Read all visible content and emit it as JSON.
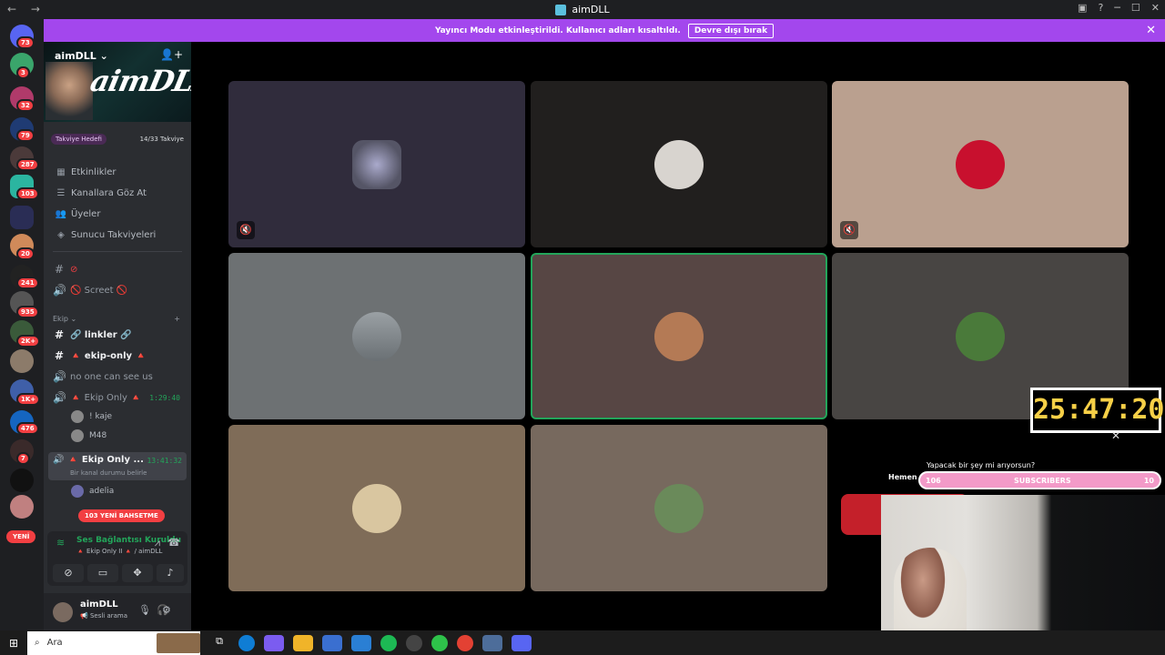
{
  "window": {
    "title": "aimDLL"
  },
  "banner": {
    "message": "Yayıncı Modu etkinleştirildi. Kullanıcı adları kısaltıldı.",
    "button": "Devre dışı bırak"
  },
  "guild_badges": [
    "73",
    "3",
    "32",
    "79",
    "287",
    "103",
    "20",
    "241",
    "935",
    "2K+",
    "1K+",
    "476",
    "7"
  ],
  "guild_new_label": "YENİ",
  "server": {
    "name": "aimDLL",
    "banner_art_text": "aimDLL",
    "boost_goal": "Takviye Hedefi",
    "boost_count": "14/33 Takviye"
  },
  "menu": [
    "Etkinlikler",
    "Kanallara Göz At",
    "Üyeler",
    "Sunucu Takviyeleri"
  ],
  "channels": {
    "screet": "🚫 Screet 🚫",
    "category": "Ekip",
    "linkler": "🔗 linkler 🔗",
    "ekip_only_text": "🔺 ekip-only 🔺",
    "hidden_voice": "no one can see us",
    "voice1": {
      "name": "🔺 Ekip Only 🔺",
      "time": "1:29:40",
      "users": [
        "! kaje",
        "M48"
      ]
    },
    "voice2": {
      "name": "🔺 Ekip Only ...",
      "time": "13:41:32",
      "status": "Bir kanal durumu belirle",
      "users": [
        "adelia"
      ]
    },
    "mention_pill": "103 YENİ BAHSETME"
  },
  "voice_status": {
    "title": "Ses Bağlantısı Kuruldu",
    "channel": "🔺 Ekip Only II 🔺 / aimDLL"
  },
  "account": {
    "name": "aimDLL",
    "status": "📢 Sesli arama"
  },
  "overlay": {
    "timer": "25:47:20",
    "prompt": "Yapacak bir şey mi arıyorsun?",
    "prompt_prefix": "Hemen",
    "sub_left": "106",
    "sub_label": "SUBSCRIBERS",
    "sub_right": "10"
  },
  "taskbar": {
    "search_placeholder": "Ara"
  },
  "colors": {
    "accent": "#a347ed",
    "danger": "#f23f42",
    "voice_green": "#23a55a"
  }
}
